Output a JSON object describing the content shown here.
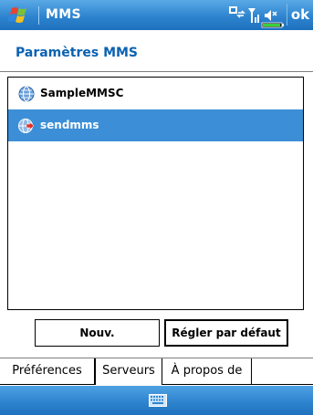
{
  "titlebar": {
    "app_title": "MMS",
    "ok_label": "ok",
    "icons": [
      "windows-start-icon",
      "data-connection-icon",
      "signal-strength-icon",
      "speaker-muted-icon",
      "battery-icon"
    ]
  },
  "header": {
    "title": "Paramètres MMS"
  },
  "servers": [
    {
      "label": "SampleMMSC",
      "icon": "globe-icon",
      "selected": false
    },
    {
      "label": "sendmms",
      "icon": "globe-arrow-icon",
      "selected": true
    }
  ],
  "buttons": {
    "new_label": "Nouv.",
    "default_label": "Régler par défaut"
  },
  "tabs": [
    {
      "label": "Préférences",
      "active": false
    },
    {
      "label": "Serveurs",
      "active": true
    },
    {
      "label": "À propos de",
      "active": false
    }
  ],
  "bottombar": {
    "icon": "keyboard-icon"
  },
  "colors": {
    "bar_blue": "#2e84cf",
    "selection_blue": "#3c8fd6",
    "title_text_blue": "#0b62b1"
  }
}
